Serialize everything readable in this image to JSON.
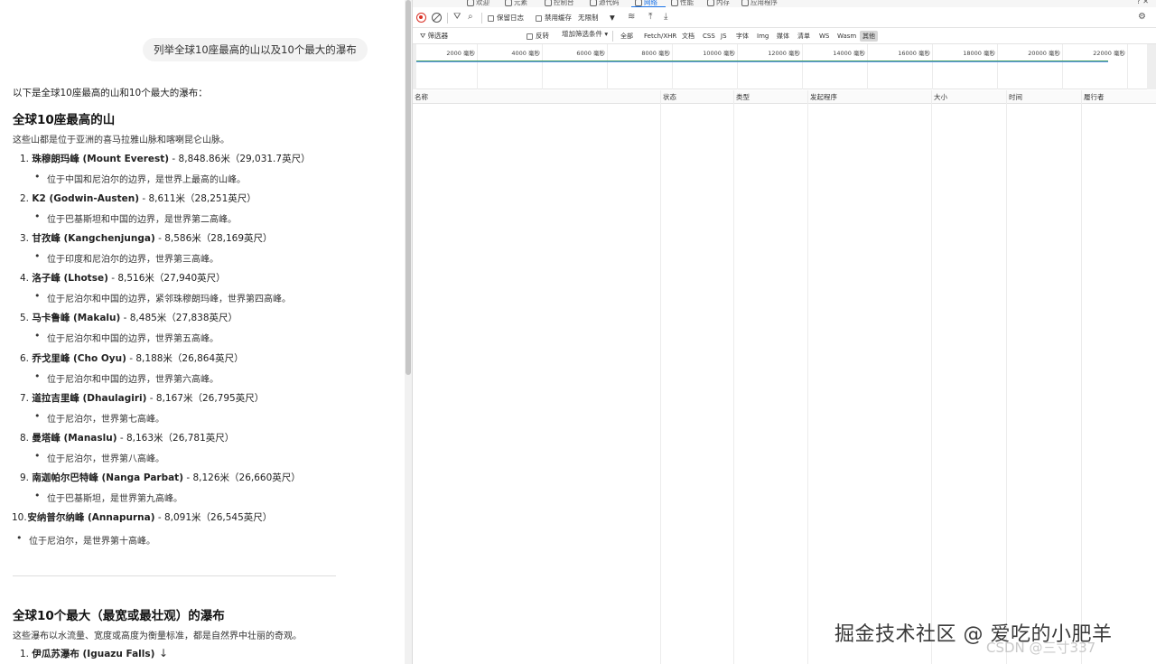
{
  "chat": {
    "user_prompt": "列举全球10座最高的山以及10个最大的瀑布",
    "intro": "以下是全球10座最高的山和10个最大的瀑布：",
    "mountains": {
      "heading": "全球10座最高的山",
      "description": "这些山都是位于亚洲的喜马拉雅山脉和喀喇昆仑山脉。",
      "items": [
        {
          "num": "1.",
          "name": "珠穆朗玛峰 (Mount Everest)",
          "detail": " - 8,848.86米（29,031.7英尺）",
          "note": "位于中国和尼泊尔的边界，是世界上最高的山峰。"
        },
        {
          "num": "2.",
          "name": "K2 (Godwin-Austen)",
          "detail": " - 8,611米（28,251英尺）",
          "note": "位于巴基斯坦和中国的边界，是世界第二高峰。"
        },
        {
          "num": "3.",
          "name": "甘孜峰 (Kangchenjunga)",
          "detail": " - 8,586米（28,169英尺）",
          "note": "位于印度和尼泊尔的边界，世界第三高峰。"
        },
        {
          "num": "4.",
          "name": "洛子峰 (Lhotse)",
          "detail": " - 8,516米（27,940英尺）",
          "note": "位于尼泊尔和中国的边界，紧邻珠穆朗玛峰，世界第四高峰。"
        },
        {
          "num": "5.",
          "name": "马卡鲁峰 (Makalu)",
          "detail": " - 8,485米（27,838英尺）",
          "note": "位于尼泊尔和中国的边界，世界第五高峰。"
        },
        {
          "num": "6.",
          "name": "乔戈里峰 (Cho Oyu)",
          "detail": " - 8,188米（26,864英尺）",
          "note": "位于尼泊尔和中国的边界，世界第六高峰。"
        },
        {
          "num": "7.",
          "name": "道拉吉里峰 (Dhaulagiri)",
          "detail": " - 8,167米（26,795英尺）",
          "note": "位于尼泊尔，世界第七高峰。"
        },
        {
          "num": "8.",
          "name": "曼塔峰 (Manaslu)",
          "detail": " - 8,163米（26,781英尺）",
          "note": "位于尼泊尔，世界第八高峰。"
        },
        {
          "num": "9.",
          "name": "南迦帕尔巴特峰 (Nanga Parbat)",
          "detail": " - 8,126米（26,660英尺）",
          "note": "位于巴基斯坦，是世界第九高峰。"
        },
        {
          "num": "10.",
          "name": "安纳普尔纳峰 (Annapurna)",
          "detail": " - 8,091米（26,545英尺）",
          "note": "位于尼泊尔，是世界第十高峰。"
        }
      ]
    },
    "waterfalls": {
      "heading": "全球10个最大（最宽或最壮观）的瀑布",
      "description": "这些瀑布以水流量、宽度或高度为衡量标准，都是自然界中壮丽的奇观。",
      "first_item": {
        "num": "1.",
        "name": "伊瓜苏瀑布 (Iguazu Falls)"
      }
    },
    "scroll_down_icon": "arrow-down-icon"
  },
  "devtools": {
    "tabs": [
      "欢迎",
      "元素",
      "控制台",
      "源代码",
      "网络",
      "性能",
      "内存",
      "应用程序"
    ],
    "active_tab": "网络",
    "toolbar": {
      "preserve_log": "保留日志",
      "disable_cache": "禁用缓存",
      "throttling": "无限制"
    },
    "filter_bar": {
      "filter_placeholder": "筛选器",
      "invert": "反转",
      "more_filters": "增加筛选条件",
      "types": [
        "全部",
        "Fetch/XHR",
        "文档",
        "CSS",
        "JS",
        "字体",
        "Img",
        "媒体",
        "清单",
        "WS",
        "Wasm",
        "其他"
      ],
      "active_type": "其他"
    },
    "timeline_labels": [
      "2000 毫秒",
      "4000 毫秒",
      "6000 毫秒",
      "8000 毫秒",
      "10000 毫秒",
      "12000 毫秒",
      "14000 毫秒",
      "16000 毫秒",
      "18000 毫秒",
      "20000 毫秒",
      "22000 毫秒"
    ],
    "columns": [
      "名称",
      "状态",
      "类型",
      "发起程序",
      "大小",
      "时间",
      "履行者"
    ]
  },
  "watermark": {
    "text": "掘金技术社区 @ 爱吃的小肥羊",
    "sub": "CSDN @三寸337"
  }
}
